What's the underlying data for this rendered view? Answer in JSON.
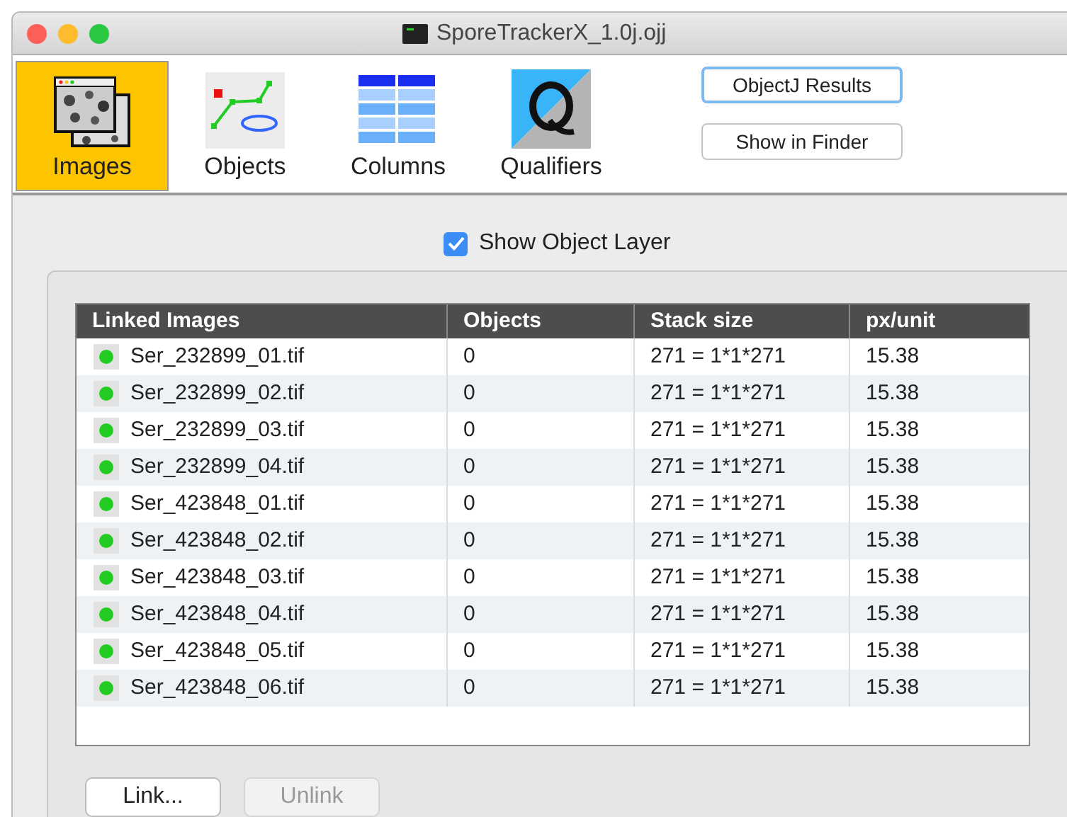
{
  "window": {
    "title": "SporeTrackerX_1.0j.ojj"
  },
  "tabs": [
    {
      "label": "Images",
      "kind": "images",
      "selected": true
    },
    {
      "label": "Objects",
      "kind": "objects",
      "selected": false
    },
    {
      "label": "Columns",
      "kind": "columns",
      "selected": false
    },
    {
      "label": "Qualifiers",
      "kind": "qualifiers",
      "selected": false
    }
  ],
  "toolbar_buttons": [
    {
      "label": "ObjectJ Results",
      "focused": true
    },
    {
      "label": "Show in Finder",
      "focused": false
    }
  ],
  "show_object_layer": {
    "label": "Show Object Layer",
    "checked": true
  },
  "table": {
    "columns": [
      "Linked Images",
      "Objects",
      "Stack size",
      "px/unit"
    ],
    "rows": [
      {
        "color": "#22cc22",
        "cells": [
          "Ser_232899_01.tif",
          "0",
          "271 = 1*1*271",
          "15.38"
        ]
      },
      {
        "color": "#22cc22",
        "cells": [
          "Ser_232899_02.tif",
          "0",
          "271 = 1*1*271",
          "15.38"
        ]
      },
      {
        "color": "#22cc22",
        "cells": [
          "Ser_232899_03.tif",
          "0",
          "271 = 1*1*271",
          "15.38"
        ]
      },
      {
        "color": "#22cc22",
        "cells": [
          "Ser_232899_04.tif",
          "0",
          "271 = 1*1*271",
          "15.38"
        ]
      },
      {
        "color": "#22cc22",
        "cells": [
          "Ser_423848_01.tif",
          "0",
          "271 = 1*1*271",
          "15.38"
        ]
      },
      {
        "color": "#22cc22",
        "cells": [
          "Ser_423848_02.tif",
          "0",
          "271 = 1*1*271",
          "15.38"
        ]
      },
      {
        "color": "#22cc22",
        "cells": [
          "Ser_423848_03.tif",
          "0",
          "271 = 1*1*271",
          "15.38"
        ]
      },
      {
        "color": "#22cc22",
        "cells": [
          "Ser_423848_04.tif",
          "0",
          "271 = 1*1*271",
          "15.38"
        ]
      },
      {
        "color": "#22cc22",
        "cells": [
          "Ser_423848_05.tif",
          "0",
          "271 = 1*1*271",
          "15.38"
        ]
      },
      {
        "color": "#22cc22",
        "cells": [
          "Ser_423848_06.tif",
          "0",
          "271 = 1*1*271",
          "15.38"
        ]
      }
    ]
  },
  "buttons": [
    {
      "label": "Link...",
      "disabled": false
    },
    {
      "label": "Unlink",
      "disabled": true
    }
  ]
}
